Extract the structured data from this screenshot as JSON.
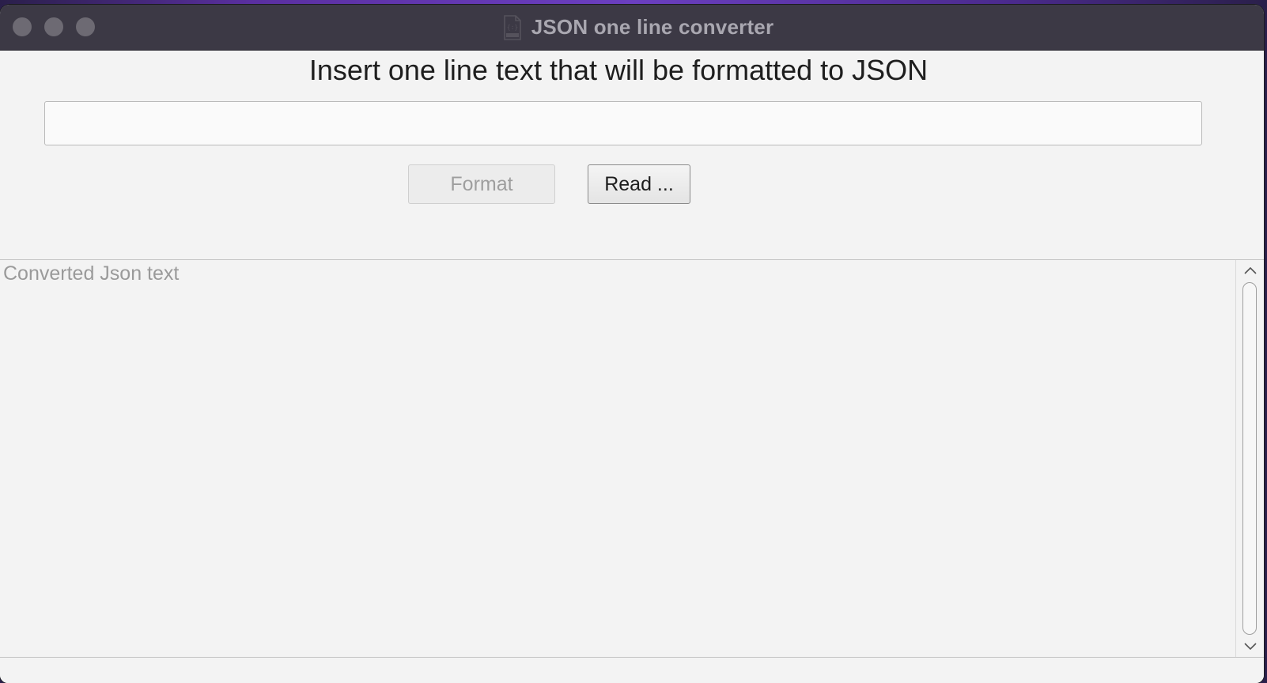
{
  "window": {
    "title": "JSON one line converter",
    "title_icon": "json-document-icon",
    "controls": [
      "close",
      "minimize",
      "zoom"
    ]
  },
  "main": {
    "heading": "Insert one line text that will be formatted to JSON",
    "input": {
      "value": "",
      "placeholder": ""
    },
    "buttons": {
      "format_label": "Format",
      "format_enabled": false,
      "read_label": "Read ..."
    }
  },
  "output": {
    "value": "",
    "placeholder": "Converted Json text"
  },
  "colors": {
    "titlebar": "#3c3945",
    "window_bg": "#f3f3f3",
    "control_dot": "#6d6a73"
  }
}
